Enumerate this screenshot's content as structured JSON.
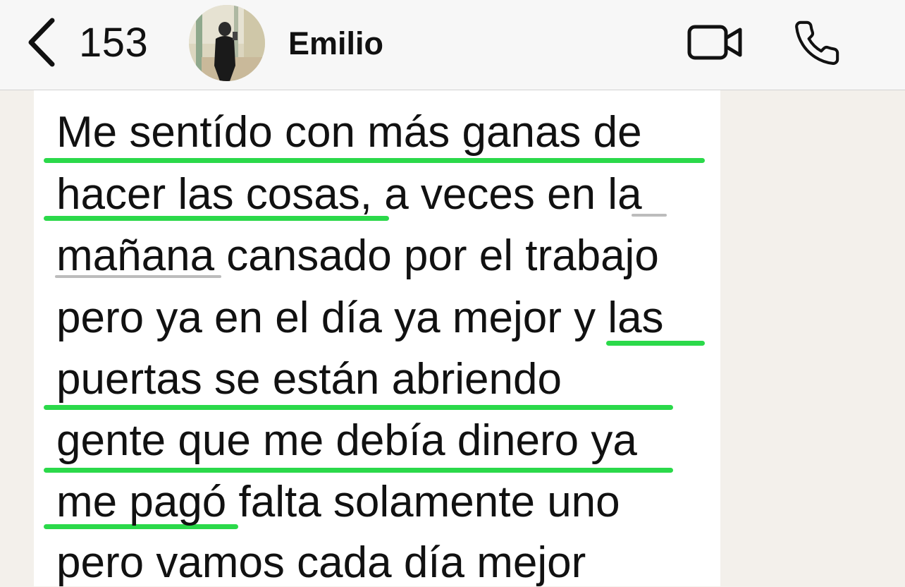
{
  "header": {
    "back_count": "153",
    "contact_name": "Emilio"
  },
  "icons": {
    "back": "chevron-left-icon",
    "video": "video-camera-icon",
    "call": "phone-icon"
  },
  "colors": {
    "header_bg": "#f7f7f7",
    "chat_bg": "#f3f0eb",
    "bubble_bg": "#ffffff",
    "highlight_green": "#2bd94a",
    "spellcheck_gray": "#bcbcbc"
  },
  "message": {
    "lines": [
      "Me sentído con más ganas de",
      "hacer las cosas, a veces en la",
      "mañana cansado por el trabajo",
      "pero ya en el día ya mejor y las",
      "puertas se están abriendo",
      "gente que me debía dinero ya",
      "me pagó falta solamente uno",
      "pero vamos cada día mejor"
    ]
  }
}
